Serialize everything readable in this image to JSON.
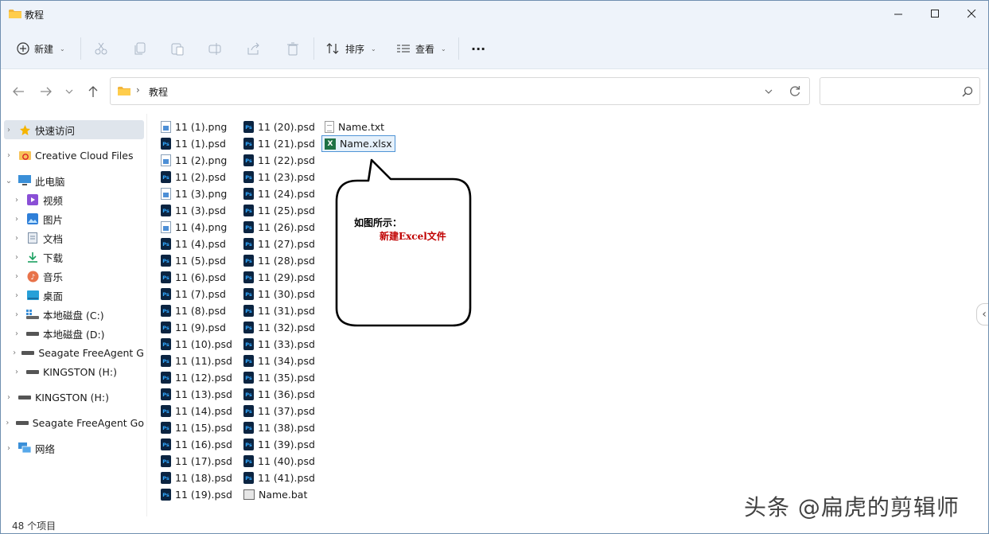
{
  "window": {
    "title": "教程",
    "controls": [
      "minimize",
      "maximize",
      "close"
    ]
  },
  "toolbar": {
    "new_label": "新建",
    "sort_label": "排序",
    "view_label": "查看",
    "more_label": "···",
    "icons": [
      "cut-icon",
      "copy-icon",
      "paste-icon",
      "rename-icon",
      "share-icon",
      "delete-icon"
    ]
  },
  "address": {
    "crumb": "教程",
    "separator": "›"
  },
  "search": {
    "placeholder": ""
  },
  "sidebar": {
    "items": [
      {
        "label": "快速访问",
        "icon": "star-icon",
        "selected": true
      },
      {
        "label": "Creative Cloud Files",
        "icon": "creative-cloud-icon"
      },
      {
        "label": "此电脑",
        "icon": "pc-icon",
        "expanded": true
      },
      {
        "label": "视频",
        "icon": "video-icon"
      },
      {
        "label": "图片",
        "icon": "pictures-icon"
      },
      {
        "label": "文档",
        "icon": "documents-icon"
      },
      {
        "label": "下载",
        "icon": "download-icon"
      },
      {
        "label": "音乐",
        "icon": "music-icon"
      },
      {
        "label": "桌面",
        "icon": "desktop-icon"
      },
      {
        "label": "本地磁盘 (C:)",
        "icon": "drive-c-icon"
      },
      {
        "label": "本地磁盘 (D:)",
        "icon": "drive-icon"
      },
      {
        "label": "Seagate FreeAgent G",
        "icon": "drive-icon"
      },
      {
        "label": "KINGSTON (H:)",
        "icon": "drive-icon"
      },
      {
        "label": "KINGSTON (H:)",
        "icon": "drive-icon"
      },
      {
        "label": "Seagate FreeAgent Go",
        "icon": "drive-icon"
      },
      {
        "label": "网络",
        "icon": "network-icon"
      }
    ]
  },
  "files": {
    "col1": [
      {
        "name": "11 (1).png",
        "type": "png"
      },
      {
        "name": "11 (1).psd",
        "type": "psd"
      },
      {
        "name": "11 (2).png",
        "type": "png"
      },
      {
        "name": "11 (2).psd",
        "type": "psd"
      },
      {
        "name": "11 (3).png",
        "type": "png"
      },
      {
        "name": "11 (3).psd",
        "type": "psd"
      },
      {
        "name": "11 (4).png",
        "type": "png"
      },
      {
        "name": "11 (4).psd",
        "type": "psd"
      },
      {
        "name": "11 (5).psd",
        "type": "psd"
      },
      {
        "name": "11 (6).psd",
        "type": "psd"
      },
      {
        "name": "11 (7).psd",
        "type": "psd"
      },
      {
        "name": "11 (8).psd",
        "type": "psd"
      },
      {
        "name": "11 (9).psd",
        "type": "psd"
      },
      {
        "name": "11 (10).psd",
        "type": "psd"
      },
      {
        "name": "11 (11).psd",
        "type": "psd"
      },
      {
        "name": "11 (12).psd",
        "type": "psd"
      },
      {
        "name": "11 (13).psd",
        "type": "psd"
      },
      {
        "name": "11 (14).psd",
        "type": "psd"
      },
      {
        "name": "11 (15).psd",
        "type": "psd"
      },
      {
        "name": "11 (16).psd",
        "type": "psd"
      },
      {
        "name": "11 (17).psd",
        "type": "psd"
      },
      {
        "name": "11 (18).psd",
        "type": "psd"
      },
      {
        "name": "11 (19).psd",
        "type": "psd"
      }
    ],
    "col2": [
      {
        "name": "11 (20).psd",
        "type": "psd"
      },
      {
        "name": "11 (21).psd",
        "type": "psd"
      },
      {
        "name": "11 (22).psd",
        "type": "psd"
      },
      {
        "name": "11 (23).psd",
        "type": "psd"
      },
      {
        "name": "11 (24).psd",
        "type": "psd"
      },
      {
        "name": "11 (25).psd",
        "type": "psd"
      },
      {
        "name": "11 (26).psd",
        "type": "psd"
      },
      {
        "name": "11 (27).psd",
        "type": "psd"
      },
      {
        "name": "11 (28).psd",
        "type": "psd"
      },
      {
        "name": "11 (29).psd",
        "type": "psd"
      },
      {
        "name": "11 (30).psd",
        "type": "psd"
      },
      {
        "name": "11 (31).psd",
        "type": "psd"
      },
      {
        "name": "11 (32).psd",
        "type": "psd"
      },
      {
        "name": "11 (33).psd",
        "type": "psd"
      },
      {
        "name": "11 (34).psd",
        "type": "psd"
      },
      {
        "name": "11 (35).psd",
        "type": "psd"
      },
      {
        "name": "11 (36).psd",
        "type": "psd"
      },
      {
        "name": "11 (37).psd",
        "type": "psd"
      },
      {
        "name": "11 (38).psd",
        "type": "psd"
      },
      {
        "name": "11 (39).psd",
        "type": "psd"
      },
      {
        "name": "11 (40).psd",
        "type": "psd"
      },
      {
        "name": "11 (41).psd",
        "type": "psd"
      },
      {
        "name": "Name.bat",
        "type": "bat"
      }
    ],
    "col3": [
      {
        "name": "Name.txt",
        "type": "txt"
      },
      {
        "name": "Name.xlsx",
        "type": "xlsx",
        "selected": true
      }
    ]
  },
  "callout": {
    "title": "如图所示：",
    "body": "新建Excel文件"
  },
  "status": {
    "item_count": "48 个项目"
  },
  "watermark": {
    "text": "头条 @扁虎的剪辑师"
  },
  "colors": {
    "chrome_bg": "#eef3fa",
    "selection": "#dfe5ec",
    "accent": "#4f94d6",
    "callout_red": "#c00000",
    "psd_bg": "#0b2441",
    "psd_fg": "#31a8ff",
    "excel_green": "#1e7145"
  }
}
